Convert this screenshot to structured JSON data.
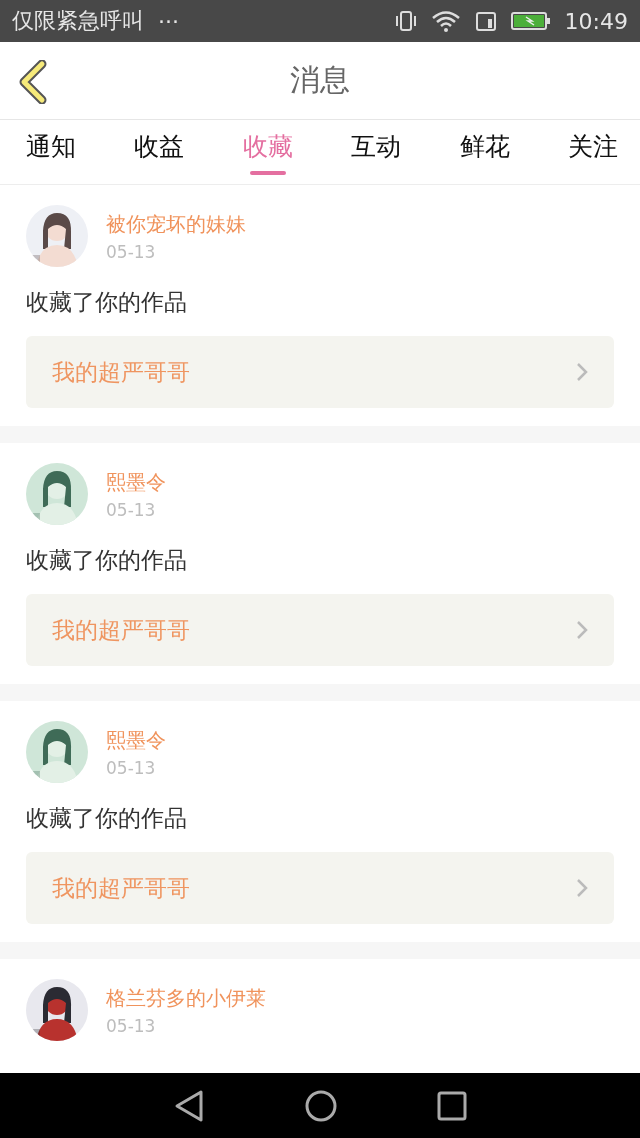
{
  "status_bar": {
    "carrier": "仅限紧急呼叫",
    "more": "···",
    "time": "10:49"
  },
  "header": {
    "title": "消息"
  },
  "tabs": [
    {
      "label": "通知",
      "selected": false
    },
    {
      "label": "收益",
      "selected": false
    },
    {
      "label": "收藏",
      "selected": true
    },
    {
      "label": "互动",
      "selected": false
    },
    {
      "label": "鲜花",
      "selected": false
    },
    {
      "label": "关注",
      "selected": false
    }
  ],
  "messages": [
    {
      "user": "被你宠坏的妹妹",
      "date": "05-13",
      "text": "收藏了你的作品",
      "work": "我的超严哥哥"
    },
    {
      "user": "熙墨令",
      "date": "05-13",
      "text": "收藏了你的作品",
      "work": "我的超严哥哥"
    },
    {
      "user": "熙墨令",
      "date": "05-13",
      "text": "收藏了你的作品",
      "work": "我的超严哥哥"
    },
    {
      "user": "格兰芬多的小伊莱",
      "date": "05-13"
    }
  ]
}
